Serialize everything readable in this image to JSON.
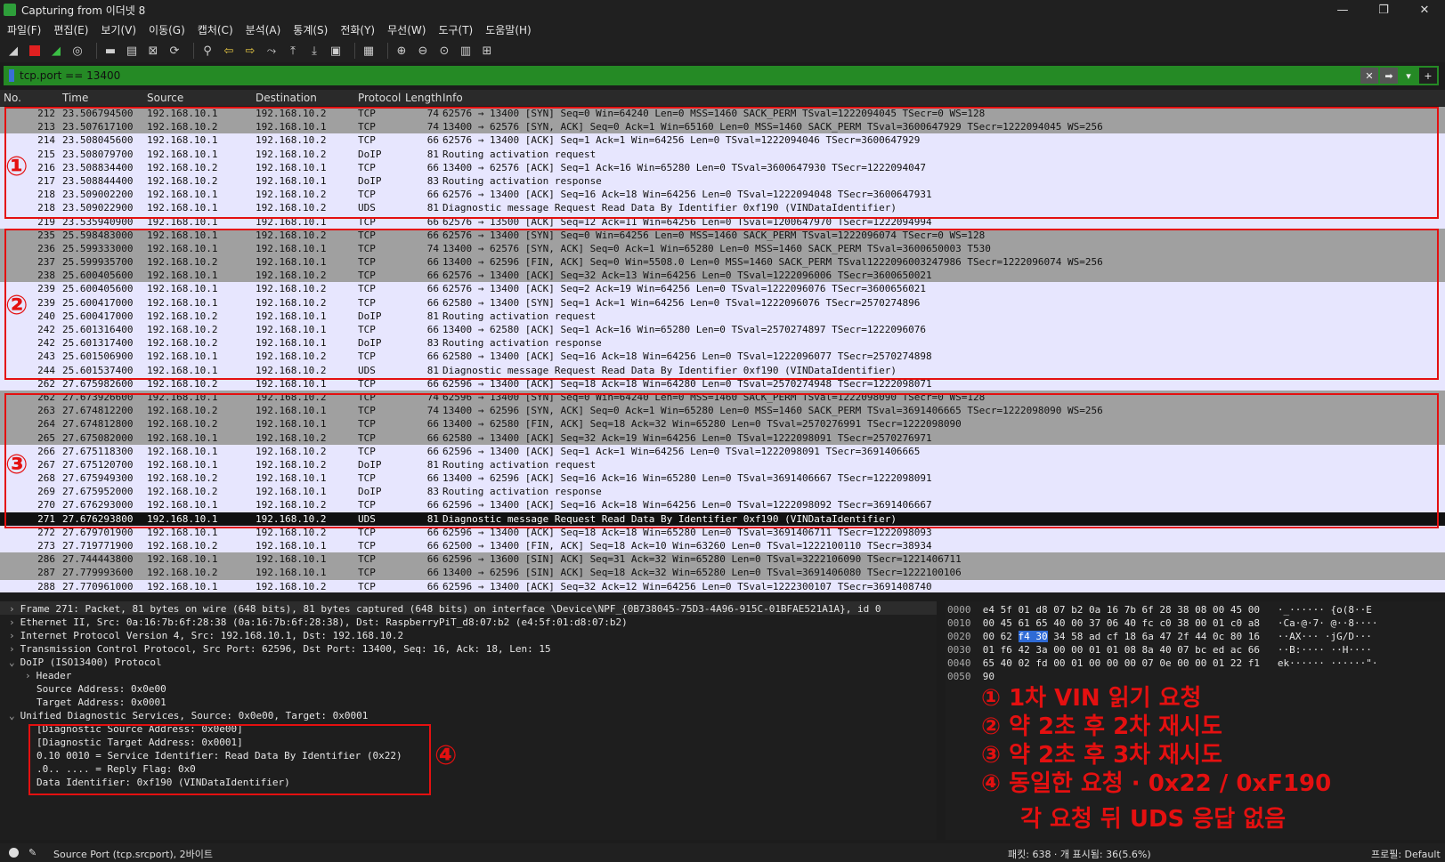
{
  "window": {
    "title": "Capturing from 이더넷 8",
    "controls": [
      "—",
      "❐",
      "✕"
    ]
  },
  "menu": [
    "파일(F)",
    "편집(E)",
    "보기(V)",
    "이동(G)",
    "캡처(C)",
    "분석(A)",
    "통계(S)",
    "전화(Y)",
    "무선(W)",
    "도구(T)",
    "도움말(H)"
  ],
  "filter": {
    "value": "tcp.port == 13400",
    "clear": "✕",
    "apply": "➡",
    "dropdown": "▾",
    "add": "+"
  },
  "columns": {
    "no": "No.",
    "time": "Time",
    "source": "Source",
    "destination": "Destination",
    "protocol": "Protocol",
    "length": "Length",
    "info": "Info"
  },
  "packets": [
    {
      "no": "212",
      "time": "23.506794500",
      "src": "192.168.10.1",
      "dst": "192.168.10.2",
      "proto": "TCP",
      "len": "74",
      "info": "62576 → 13400 [SYN] Seq=0 Win=64240 Len=0 MSS=1460 SACK_PERM TSval=1222094045 TSecr=0 WS=128",
      "style": "tcp-gray"
    },
    {
      "no": "213",
      "time": "23.507617100",
      "src": "192.168.10.2",
      "dst": "192.168.10.1",
      "proto": "TCP",
      "len": "74",
      "info": "13400 → 62576 [SYN, ACK] Seq=0 Ack=1 Win=65160 Len=0 MSS=1460 SACK_PERM TSval=3600647929 TSecr=1222094045 WS=256",
      "style": "tcp-gray"
    },
    {
      "no": "214",
      "time": "23.508045600",
      "src": "192.168.10.1",
      "dst": "192.168.10.2",
      "proto": "TCP",
      "len": "66",
      "info": "62576 → 13400 [ACK] Seq=1 Ack=1 Win=64256 Len=0 TSval=1222094046 TSecr=3600647929",
      "style": "lav"
    },
    {
      "no": "215",
      "time": "23.508079700",
      "src": "192.168.10.1",
      "dst": "192.168.10.2",
      "proto": "DoIP",
      "len": "81",
      "info": "Routing activation request",
      "style": "lav"
    },
    {
      "no": "216",
      "time": "23.508834400",
      "src": "192.168.10.2",
      "dst": "192.168.10.1",
      "proto": "TCP",
      "len": "66",
      "info": "13400 → 62576 [ACK] Seq=1 Ack=16 Win=65280 Len=0 TSval=3600647930 TSecr=1222094047",
      "style": "lav"
    },
    {
      "no": "217",
      "time": "23.508844400",
      "src": "192.168.10.2",
      "dst": "192.168.10.1",
      "proto": "DoIP",
      "len": "83",
      "info": "Routing activation response",
      "style": "lav"
    },
    {
      "no": "218",
      "time": "23.509002200",
      "src": "192.168.10.1",
      "dst": "192.168.10.2",
      "proto": "TCP",
      "len": "66",
      "info": "62576 → 13400 [ACK] Seq=16 Ack=18 Win=64256 Len=0 TSval=1222094048 TSecr=3600647931",
      "style": "lav"
    },
    {
      "no": "218",
      "time": "23.509022900",
      "src": "192.168.10.1",
      "dst": "192.168.10.2",
      "proto": "UDS",
      "len": "81",
      "info": "Diagnostic message Request   Read Data By Identifier              0xf190 (VINDataIdentifier)",
      "style": "lav"
    },
    {
      "no": "219",
      "time": "23.535940900",
      "src": "192.168.10.1",
      "dst": "192.168.10.1",
      "proto": "TCP",
      "len": "66",
      "info": "62576 → 13500 [ACK] Seq=12 Ack=11 Win=64256 Len=0 TSval=1200647970 TSecr=1222094994",
      "style": "lav"
    },
    {
      "no": "235",
      "time": "25.598483000",
      "src": "192.168.10.1",
      "dst": "192.168.10.2",
      "proto": "TCP",
      "len": "66",
      "info": "62576 → 13400 [SYN] Seq=0 Win=64256 Len=0 MSS=1460 SACK_PERM TSval=1222096074 TSecr=0 WS=128",
      "style": "tcp-gray"
    },
    {
      "no": "236",
      "time": "25.599333000",
      "src": "192.168.10.1",
      "dst": "192.168.10.1",
      "proto": "TCP",
      "len": "74",
      "info": "13400 → 62576 [SYN, ACK] Seq=0 Ack=1 Win=65280 Len=0 MSS=1460 SACK_PERM TSval=3600650003 T530",
      "style": "tcp-gray"
    },
    {
      "no": "237",
      "time": "25.599935700",
      "src": "192.168.10.2",
      "dst": "192.168.10.1",
      "proto": "TCP",
      "len": "66",
      "info": "13400 → 62596 [FIN, ACK] Seq=0 Win=5508.0 Len=0 MSS=1460 SACK_PERM TSval1222096003247986 TSecr=1222096074 WS=256",
      "style": "tcp-gray"
    },
    {
      "no": "238",
      "time": "25.600405600",
      "src": "192.168.10.1",
      "dst": "192.168.10.2",
      "proto": "TCP",
      "len": "66",
      "info": "62576 → 13400 [ACK] Seq=32 Ack=13 Win=64256 Len=0 TSval=1222096006 TSecr=3600650021",
      "style": "tcp-gray"
    },
    {
      "no": "239",
      "time": "25.600405600",
      "src": "192.168.10.1",
      "dst": "192.168.10.2",
      "proto": "TCP",
      "len": "66",
      "info": "62576 → 13400 [ACK] Seq=2 Ack=19 Win=64256 Len=0 TSval=1222096076 TSecr=3600656021",
      "style": "lav"
    },
    {
      "no": "239",
      "time": "25.600417000",
      "src": "192.168.10.1",
      "dst": "192.168.10.2",
      "proto": "TCP",
      "len": "66",
      "info": "62580 → 13400 [SYN] Seq=1 Ack=1 Win=64256 Len=0 TSval=1222096076 TSecr=2570274896",
      "style": "lav"
    },
    {
      "no": "240",
      "time": "25.600417000",
      "src": "192.168.10.2",
      "dst": "192.168.10.1",
      "proto": "DoIP",
      "len": "81",
      "info": "Routing activation request",
      "style": "lav"
    },
    {
      "no": "242",
      "time": "25.601316400",
      "src": "192.168.10.2",
      "dst": "192.168.10.1",
      "proto": "TCP",
      "len": "66",
      "info": "13400 → 62580 [ACK] Seq=1 Ack=16 Win=65280 Len=0 TSval=2570274897 TSecr=1222096076",
      "style": "lav"
    },
    {
      "no": "242",
      "time": "25.601317400",
      "src": "192.168.10.2",
      "dst": "192.168.10.1",
      "proto": "DoIP",
      "len": "83",
      "info": "Routing activation response",
      "style": "lav"
    },
    {
      "no": "243",
      "time": "25.601506900",
      "src": "192.168.10.1",
      "dst": "192.168.10.2",
      "proto": "TCP",
      "len": "66",
      "info": "62580 → 13400 [ACK] Seq=16 Ack=18 Win=64256 Len=0 TSval=1222096077 TSecr=2570274898",
      "style": "lav"
    },
    {
      "no": "244",
      "time": "25.601537400",
      "src": "192.168.10.1",
      "dst": "192.168.10.2",
      "proto": "UDS",
      "len": "81",
      "info": "Diagnostic message Request   Read Data By Identifier              0xf190 (VINDataIdentifier)",
      "style": "lav"
    },
    {
      "no": "262",
      "time": "27.675982600",
      "src": "192.168.10.2",
      "dst": "192.168.10.1",
      "proto": "TCP",
      "len": "66",
      "info": "62596 → 13400 [ACK] Seq=18 Ack=18 Win=64280 Len=0 TSval=2570274948 TSecr=1222098071",
      "style": "lav"
    },
    {
      "no": "262",
      "time": "27.673926600",
      "src": "192.168.10.1",
      "dst": "192.168.10.2",
      "proto": "TCP",
      "len": "74",
      "info": "62596 → 13400 [SYN] Seq=0 Win=64240 Len=0 MSS=1460 SACK_PERM TSval=1222098090 TSecr=0 WS=128",
      "style": "tcp-gray"
    },
    {
      "no": "263",
      "time": "27.674812200",
      "src": "192.168.10.2",
      "dst": "192.168.10.1",
      "proto": "TCP",
      "len": "74",
      "info": "13400 → 62596 [SYN, ACK] Seq=0 Ack=1 Win=65280 Len=0 MSS=1460 SACK_PERM TSval=3691406665 TSecr=1222098090 WS=256",
      "style": "tcp-gray"
    },
    {
      "no": "264",
      "time": "27.674812800",
      "src": "192.168.10.2",
      "dst": "192.168.10.1",
      "proto": "TCP",
      "len": "66",
      "info": "13400 → 62580 [FIN, ACK] Seq=18 Ack=32 Win=65280 Len=0 TSval=2570276991 TSecr=1222098090",
      "style": "tcp-gray"
    },
    {
      "no": "265",
      "time": "27.675082000",
      "src": "192.168.10.1",
      "dst": "192.168.10.2",
      "proto": "TCP",
      "len": "66",
      "info": "62580 → 13400 [ACK] Seq=32 Ack=19 Win=64256 Len=0 TSval=1222098091 TSecr=2570276971",
      "style": "tcp-gray"
    },
    {
      "no": "266",
      "time": "27.675118300",
      "src": "192.168.10.1",
      "dst": "192.168.10.2",
      "proto": "TCP",
      "len": "66",
      "info": "62596 → 13400 [ACK] Seq=1 Ack=1 Win=64256 Len=0 TSval=1222098091 TSecr=3691406665",
      "style": "lav"
    },
    {
      "no": "267",
      "time": "27.675120700",
      "src": "192.168.10.1",
      "dst": "192.168.10.2",
      "proto": "DoIP",
      "len": "81",
      "info": "Routing activation request",
      "style": "lav"
    },
    {
      "no": "268",
      "time": "27.675949300",
      "src": "192.168.10.2",
      "dst": "192.168.10.1",
      "proto": "TCP",
      "len": "66",
      "info": "13400 → 62596 [ACK] Seq=16 Ack=16 Win=65280 Len=0 TSval=3691406667 TSecr=1222098091",
      "style": "lav"
    },
    {
      "no": "269",
      "time": "27.675952000",
      "src": "192.168.10.2",
      "dst": "192.168.10.1",
      "proto": "DoIP",
      "len": "83",
      "info": "Routing activation response",
      "style": "lav"
    },
    {
      "no": "270",
      "time": "27.676293000",
      "src": "192.168.10.1",
      "dst": "192.168.10.2",
      "proto": "TCP",
      "len": "66",
      "info": "62596 → 13400 [ACK] Seq=16 Ack=18 Win=64256 Len=0 TSval=1222098092 TSecr=3691406667",
      "style": "lav"
    },
    {
      "no": "271",
      "time": "27.676293800",
      "src": "192.168.10.1",
      "dst": "192.168.10.2",
      "proto": "UDS",
      "len": "81",
      "info": "Diagnostic message Request   Read Data By Identifier              0xf190 (VINDataIdentifier)",
      "style": "sel"
    },
    {
      "no": "272",
      "time": "27.679701900",
      "src": "192.168.10.1",
      "dst": "192.168.10.2",
      "proto": "TCP",
      "len": "66",
      "info": "62596 → 13400 [ACK] Seq=18 Ack=18 Win=65280 Len=0 TSval=3691406711 TSecr=1222098093",
      "style": "lav"
    },
    {
      "no": "273",
      "time": "27.719771900",
      "src": "192.168.10.2",
      "dst": "192.168.10.1",
      "proto": "TCP",
      "len": "66",
      "info": "62500 → 13400 [FIN, ACK] Seq=18 Ack=10 Win=63260 Len=0 TSval=1222100110 TSecr=38934",
      "style": "lav"
    },
    {
      "no": "286",
      "time": "27.744443800",
      "src": "192.168.10.1",
      "dst": "192.168.10.1",
      "proto": "TCP",
      "len": "66",
      "info": "62596 → 13600 [SIN] ACK] Seq=31 Ack=32 Win=65280 Len=0 TSval=3222106090 TSecr=1221406711",
      "style": "tcp-gray"
    },
    {
      "no": "287",
      "time": "27.779993600",
      "src": "192.168.10.2",
      "dst": "192.168.10.1",
      "proto": "TCP",
      "len": "66",
      "info": "13400 → 62596 [SIN] ACK] Seq=18 Ack=32 Win=65280 Len=0 TSval=3691406080 TSecr=1222100106",
      "style": "tcp-gray"
    },
    {
      "no": "288",
      "time": "27.770961000",
      "src": "192.168.10.1",
      "dst": "192.168.10.2",
      "proto": "TCP",
      "len": "66",
      "info": "62596 → 13400 [ACK] Seq=32 Ack=12 Win=64256 Len=0 TSval=1222300107 TSecr=3691408740",
      "style": "lav"
    }
  ],
  "marks": {
    "m1": "①",
    "m2": "②",
    "m3": "③",
    "m4": "④"
  },
  "details": [
    {
      "tw": "›",
      "text": "Frame 271: Packet, 81 bytes on wire (648 bits), 81 bytes captured (648 bits) on interface \\Device\\NPF_{0B738045-75D3-4A96-915C-01BFAE521A1A}, id 0"
    },
    {
      "tw": "›",
      "text": "Ethernet II, Src: 0a:16:7b:6f:28:38 (0a:16:7b:6f:28:38), Dst: RaspberryPiT_d8:07:b2 (e4:5f:01:d8:07:b2)"
    },
    {
      "tw": "›",
      "text": "Internet Protocol Version 4, Src: 192.168.10.1, Dst: 192.168.10.2"
    },
    {
      "tw": "›",
      "text": "Transmission Control Protocol, Src Port: 62596, Dst Port: 13400, Seq: 16, Ack: 18, Len: 15"
    },
    {
      "tw": "⌄",
      "text": "DoIP (ISO13400) Protocol"
    },
    {
      "tw": "›",
      "text": "Header"
    },
    {
      "tw": "",
      "text": "Source Address: 0x0e00"
    },
    {
      "tw": "",
      "text": "Target Address: 0x0001"
    },
    {
      "tw": "⌄",
      "text": "Unified Diagnostic Services, Source: 0x0e00, Target: 0x0001"
    },
    {
      "tw": "",
      "text": "[Diagnostic Source Address: 0x0e00]"
    },
    {
      "tw": "",
      "text": "[Diagnostic Target Address: 0x0001]"
    },
    {
      "tw": "",
      "text": "0.10 0010 = Service Identifier: Read Data By Identifier (0x22)"
    },
    {
      "tw": "",
      "text": ".0.. .... = Reply Flag: 0x0"
    },
    {
      "tw": "",
      "text": "Data Identifier: 0xf190 (VINDataIdentifier)"
    }
  ],
  "bytes": [
    {
      "off": "0000",
      "pre": "e4 5f 01 d8 07 b2 0a 16  7b 6f 28 38 08 00 45 00",
      "sel": "",
      "post": "",
      "ascii": "·_······ {o(8··E"
    },
    {
      "off": "0010",
      "pre": "00 45 61 65 40 00 37 06  40 fc c0 38 00 01 c0 a8",
      "sel": "",
      "post": "",
      "ascii": "·Ca·@·7· @··8····"
    },
    {
      "off": "0020",
      "pre": "00 62 ",
      "sel": "f4 30",
      "post": " 34 58 ad cf  18 6a 47 2f 44 0c 80 16",
      "ascii": "··AX··· ·jG/D···"
    },
    {
      "off": "0030",
      "pre": "01 f6 42 3a 00 00 01 01  08 8a 40 07 bc ed ac 66",
      "sel": "",
      "post": "",
      "ascii": "··B:···· ··H····"
    },
    {
      "off": "0040",
      "pre": "65 40 02 fd 00 01 00 00  00 07 0e 00 00 01 22 f1",
      "sel": "",
      "post": "",
      "ascii": "ek······ ······\"·"
    },
    {
      "off": "0050",
      "pre": "90",
      "sel": "",
      "post": "",
      "ascii": "·"
    }
  ],
  "annotations": [
    "① 1차 VIN 읽기 요청",
    "② 약 2초 후 2차 재시도",
    "③ 약 2초 후 3차 재시도",
    "④ 동일한 요청 · 0x22 / 0xF190",
    "각 요청 뒤 UDS 응답 없음"
  ],
  "status": {
    "field": "Source Port (tcp.srcport), 2바이트",
    "packets": "패킷: 638 · 개 표시됨: 36(5.6%)",
    "profile": "프로필: Default"
  },
  "colors": {
    "filter_valid": "#258a25",
    "tcp_gray": "#a0a0a0",
    "lavender": "#e7e6fe",
    "annotation_red": "#e41010",
    "byte_highlight": "#2f6bd6"
  }
}
